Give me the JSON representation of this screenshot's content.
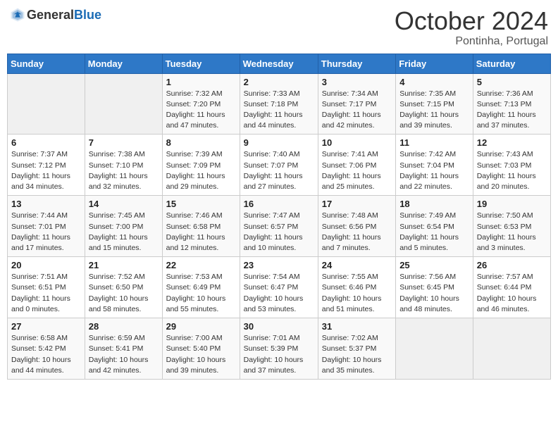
{
  "header": {
    "logo_general": "General",
    "logo_blue": "Blue",
    "month": "October 2024",
    "location": "Pontinha, Portugal"
  },
  "columns": [
    "Sunday",
    "Monday",
    "Tuesday",
    "Wednesday",
    "Thursday",
    "Friday",
    "Saturday"
  ],
  "weeks": [
    [
      {
        "day": "",
        "info": ""
      },
      {
        "day": "",
        "info": ""
      },
      {
        "day": "1",
        "info": "Sunrise: 7:32 AM\nSunset: 7:20 PM\nDaylight: 11 hours and 47 minutes."
      },
      {
        "day": "2",
        "info": "Sunrise: 7:33 AM\nSunset: 7:18 PM\nDaylight: 11 hours and 44 minutes."
      },
      {
        "day": "3",
        "info": "Sunrise: 7:34 AM\nSunset: 7:17 PM\nDaylight: 11 hours and 42 minutes."
      },
      {
        "day": "4",
        "info": "Sunrise: 7:35 AM\nSunset: 7:15 PM\nDaylight: 11 hours and 39 minutes."
      },
      {
        "day": "5",
        "info": "Sunrise: 7:36 AM\nSunset: 7:13 PM\nDaylight: 11 hours and 37 minutes."
      }
    ],
    [
      {
        "day": "6",
        "info": "Sunrise: 7:37 AM\nSunset: 7:12 PM\nDaylight: 11 hours and 34 minutes."
      },
      {
        "day": "7",
        "info": "Sunrise: 7:38 AM\nSunset: 7:10 PM\nDaylight: 11 hours and 32 minutes."
      },
      {
        "day": "8",
        "info": "Sunrise: 7:39 AM\nSunset: 7:09 PM\nDaylight: 11 hours and 29 minutes."
      },
      {
        "day": "9",
        "info": "Sunrise: 7:40 AM\nSunset: 7:07 PM\nDaylight: 11 hours and 27 minutes."
      },
      {
        "day": "10",
        "info": "Sunrise: 7:41 AM\nSunset: 7:06 PM\nDaylight: 11 hours and 25 minutes."
      },
      {
        "day": "11",
        "info": "Sunrise: 7:42 AM\nSunset: 7:04 PM\nDaylight: 11 hours and 22 minutes."
      },
      {
        "day": "12",
        "info": "Sunrise: 7:43 AM\nSunset: 7:03 PM\nDaylight: 11 hours and 20 minutes."
      }
    ],
    [
      {
        "day": "13",
        "info": "Sunrise: 7:44 AM\nSunset: 7:01 PM\nDaylight: 11 hours and 17 minutes."
      },
      {
        "day": "14",
        "info": "Sunrise: 7:45 AM\nSunset: 7:00 PM\nDaylight: 11 hours and 15 minutes."
      },
      {
        "day": "15",
        "info": "Sunrise: 7:46 AM\nSunset: 6:58 PM\nDaylight: 11 hours and 12 minutes."
      },
      {
        "day": "16",
        "info": "Sunrise: 7:47 AM\nSunset: 6:57 PM\nDaylight: 11 hours and 10 minutes."
      },
      {
        "day": "17",
        "info": "Sunrise: 7:48 AM\nSunset: 6:56 PM\nDaylight: 11 hours and 7 minutes."
      },
      {
        "day": "18",
        "info": "Sunrise: 7:49 AM\nSunset: 6:54 PM\nDaylight: 11 hours and 5 minutes."
      },
      {
        "day": "19",
        "info": "Sunrise: 7:50 AM\nSunset: 6:53 PM\nDaylight: 11 hours and 3 minutes."
      }
    ],
    [
      {
        "day": "20",
        "info": "Sunrise: 7:51 AM\nSunset: 6:51 PM\nDaylight: 11 hours and 0 minutes."
      },
      {
        "day": "21",
        "info": "Sunrise: 7:52 AM\nSunset: 6:50 PM\nDaylight: 10 hours and 58 minutes."
      },
      {
        "day": "22",
        "info": "Sunrise: 7:53 AM\nSunset: 6:49 PM\nDaylight: 10 hours and 55 minutes."
      },
      {
        "day": "23",
        "info": "Sunrise: 7:54 AM\nSunset: 6:47 PM\nDaylight: 10 hours and 53 minutes."
      },
      {
        "day": "24",
        "info": "Sunrise: 7:55 AM\nSunset: 6:46 PM\nDaylight: 10 hours and 51 minutes."
      },
      {
        "day": "25",
        "info": "Sunrise: 7:56 AM\nSunset: 6:45 PM\nDaylight: 10 hours and 48 minutes."
      },
      {
        "day": "26",
        "info": "Sunrise: 7:57 AM\nSunset: 6:44 PM\nDaylight: 10 hours and 46 minutes."
      }
    ],
    [
      {
        "day": "27",
        "info": "Sunrise: 6:58 AM\nSunset: 5:42 PM\nDaylight: 10 hours and 44 minutes."
      },
      {
        "day": "28",
        "info": "Sunrise: 6:59 AM\nSunset: 5:41 PM\nDaylight: 10 hours and 42 minutes."
      },
      {
        "day": "29",
        "info": "Sunrise: 7:00 AM\nSunset: 5:40 PM\nDaylight: 10 hours and 39 minutes."
      },
      {
        "day": "30",
        "info": "Sunrise: 7:01 AM\nSunset: 5:39 PM\nDaylight: 10 hours and 37 minutes."
      },
      {
        "day": "31",
        "info": "Sunrise: 7:02 AM\nSunset: 5:37 PM\nDaylight: 10 hours and 35 minutes."
      },
      {
        "day": "",
        "info": ""
      },
      {
        "day": "",
        "info": ""
      }
    ]
  ]
}
